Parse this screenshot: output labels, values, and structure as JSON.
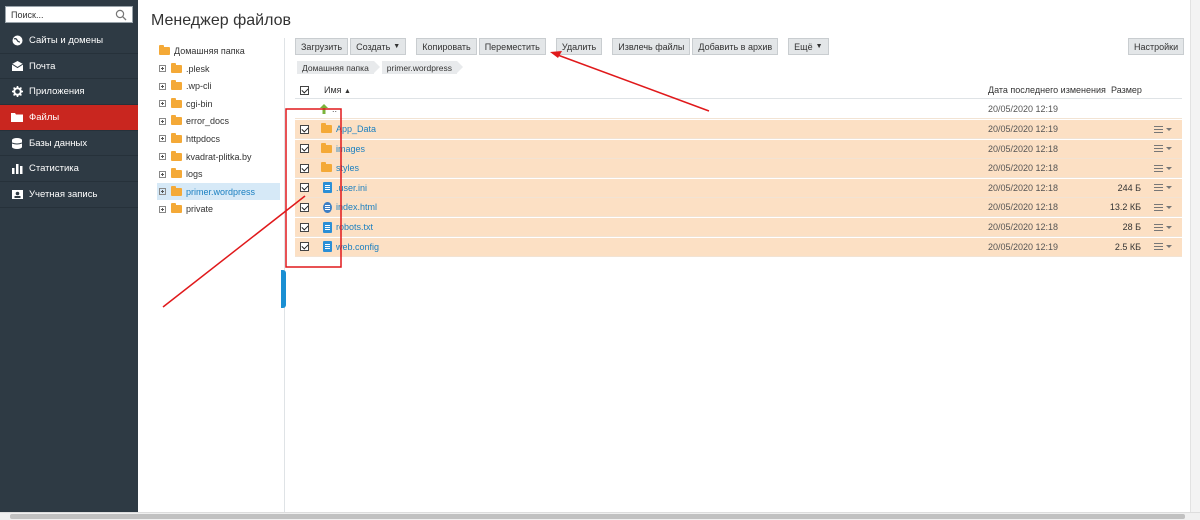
{
  "sidebar": {
    "search_placeholder": "Поиск...",
    "items": [
      {
        "label": "Сайты и домены",
        "icon": "globe-icon"
      },
      {
        "label": "Почта",
        "icon": "mail-icon"
      },
      {
        "label": "Приложения",
        "icon": "gear-icon"
      },
      {
        "label": "Файлы",
        "icon": "folder-icon",
        "active": true
      },
      {
        "label": "Базы данных",
        "icon": "database-icon"
      },
      {
        "label": "Статистика",
        "icon": "bar-chart-icon"
      },
      {
        "label": "Учетная запись",
        "icon": "account-icon"
      }
    ]
  },
  "page": {
    "title": "Менеджер файлов"
  },
  "tree": {
    "root": "Домашняя папка",
    "items": [
      ".plesk",
      ".wp-cli",
      "cgi-bin",
      "error_docs",
      "httpdocs",
      "kvadrat-plitka.by",
      "logs",
      "primer.wordpress",
      "private"
    ],
    "selected": "primer.wordpress"
  },
  "toolbar": {
    "upload": "Загрузить",
    "create": "Создать",
    "copy": "Копировать",
    "move": "Переместить",
    "delete": "Удалить",
    "extract": "Извлечь файлы",
    "archive": "Добавить в архив",
    "more": "Ещё",
    "settings": "Настройки"
  },
  "breadcrumb": [
    "Домашняя папка",
    "primer.wordpress"
  ],
  "table": {
    "col_name": "Имя",
    "col_date": "Дата последнего изменения",
    "col_size": "Размер",
    "up_row": {
      "name": "..",
      "date": "20/05/2020 12:19"
    },
    "rows": [
      {
        "name": "App_Data",
        "type": "folder",
        "date": "20/05/2020 12:19",
        "size": ""
      },
      {
        "name": "images",
        "type": "folder",
        "date": "20/05/2020 12:18",
        "size": ""
      },
      {
        "name": "styles",
        "type": "folder",
        "date": "20/05/2020 12:18",
        "size": ""
      },
      {
        "name": ".user.ini",
        "type": "file",
        "date": "20/05/2020 12:18",
        "size": "244 Б"
      },
      {
        "name": "index.html",
        "type": "html",
        "date": "20/05/2020 12:18",
        "size": "13.2 КБ"
      },
      {
        "name": "robots.txt",
        "type": "file",
        "date": "20/05/2020 12:18",
        "size": "28 Б"
      },
      {
        "name": "web.config",
        "type": "file",
        "date": "20/05/2020 12:19",
        "size": "2.5 КБ"
      }
    ]
  },
  "colors": {
    "sidebar_bg": "#2e3a44",
    "active_nav": "#c9261f",
    "selected_row": "#fce0c4",
    "link": "#1a7fc0",
    "annotation": "#e0191b"
  }
}
